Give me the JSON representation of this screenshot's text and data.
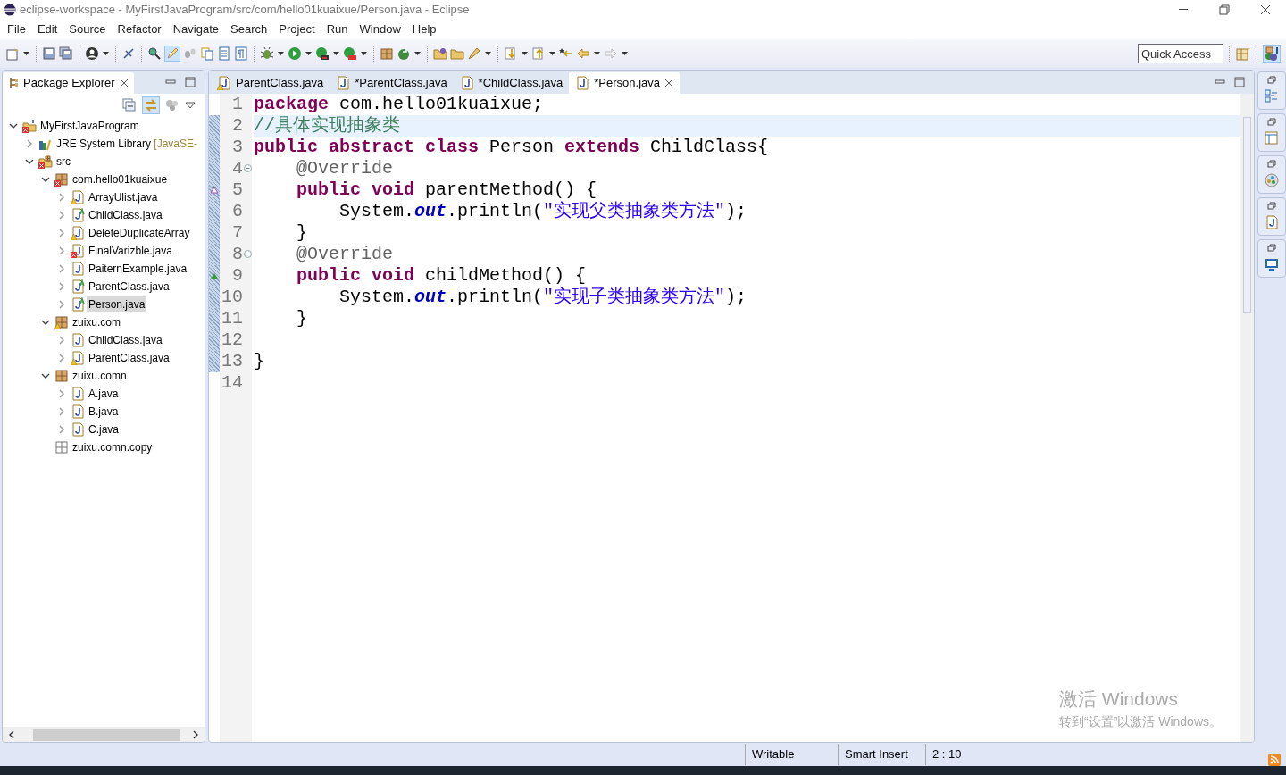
{
  "window": {
    "title": "eclipse-workspace - MyFirstJavaProgram/src/com/hello01kuaixue/Person.java - Eclipse"
  },
  "menu": [
    "File",
    "Edit",
    "Source",
    "Refactor",
    "Navigate",
    "Search",
    "Project",
    "Run",
    "Window",
    "Help"
  ],
  "quick_access": {
    "placeholder": "Quick Access"
  },
  "package_explorer": {
    "title": "Package Explorer",
    "link_with_editor": true,
    "tree": [
      {
        "label": "MyFirstJavaProgram",
        "kind": "project",
        "error": true,
        "expanded": true,
        "selected": false,
        "children": [
          {
            "label": "JRE System Library",
            "decoration": "[JavaSE-",
            "kind": "library",
            "expanded": false,
            "selected": false
          },
          {
            "label": "src",
            "kind": "folder",
            "error": true,
            "expanded": true,
            "selected": false,
            "children": [
              {
                "label": "com.hello01kuaixue",
                "kind": "package",
                "error": true,
                "expanded": true,
                "selected": false,
                "children": [
                  {
                    "label": "ArrayUlist.java",
                    "kind": "file",
                    "warning": true,
                    "expanded": false,
                    "selected": false
                  },
                  {
                    "label": "ChildClass.java",
                    "kind": "file",
                    "abstract": true,
                    "expanded": false,
                    "selected": false
                  },
                  {
                    "label": "DeleteDuplicateArray",
                    "kind": "file",
                    "warning": true,
                    "expanded": false,
                    "selected": false
                  },
                  {
                    "label": "FinalVarizble.java",
                    "kind": "file",
                    "error": true,
                    "expanded": false,
                    "selected": false
                  },
                  {
                    "label": "PaiternExample.java",
                    "kind": "file",
                    "expanded": false,
                    "selected": false
                  },
                  {
                    "label": "ParentClass.java",
                    "kind": "file",
                    "abstract": true,
                    "expanded": false,
                    "selected": false
                  },
                  {
                    "label": "Person.java",
                    "kind": "file",
                    "abstract": true,
                    "expanded": false,
                    "selected": true
                  }
                ]
              },
              {
                "label": "zuixu.com",
                "kind": "package",
                "warning": true,
                "expanded": true,
                "selected": false,
                "children": [
                  {
                    "label": "ChildClass.java",
                    "kind": "file",
                    "expanded": false,
                    "selected": false
                  },
                  {
                    "label": "ParentClass.java",
                    "kind": "file",
                    "warning": true,
                    "expanded": false,
                    "selected": false
                  }
                ]
              },
              {
                "label": "zuixu.comn",
                "kind": "package",
                "expanded": true,
                "selected": false,
                "children": [
                  {
                    "label": "A.java",
                    "kind": "file",
                    "expanded": false,
                    "selected": false
                  },
                  {
                    "label": "B.java",
                    "kind": "file",
                    "expanded": false,
                    "selected": false
                  },
                  {
                    "label": "C.java",
                    "kind": "file",
                    "expanded": false,
                    "selected": false
                  }
                ]
              },
              {
                "label": "zuixu.comn.copy",
                "kind": "empty-package",
                "selected": false
              }
            ]
          }
        ]
      }
    ]
  },
  "editor_tabs": [
    {
      "label": "ParentClass.java",
      "warning": true,
      "selected": false
    },
    {
      "label": "*ParentClass.java",
      "selected": false
    },
    {
      "label": "*ChildClass.java",
      "selected": false
    },
    {
      "label": "*Person.java",
      "selected": true
    }
  ],
  "code_lines": [
    {
      "number": "1",
      "changed": false,
      "current": false,
      "tokens": [
        {
          "kind": "keyword",
          "text": "package"
        },
        {
          "kind": "plain",
          "text": " com.hello01kuaixue;"
        }
      ]
    },
    {
      "number": "2",
      "changed": true,
      "current": true,
      "tokens": [
        {
          "kind": "comment",
          "text": "//具体实现抽象类"
        }
      ]
    },
    {
      "number": "3",
      "changed": true,
      "current": false,
      "tokens": [
        {
          "kind": "keyword",
          "text": "public"
        },
        {
          "kind": "keyword",
          "text": " abstract"
        },
        {
          "kind": "keyword",
          "text": " class"
        },
        {
          "kind": "plain",
          "text": " Person"
        },
        {
          "kind": "keyword",
          "text": " extends"
        },
        {
          "kind": "plain",
          "text": " ChildClass{"
        }
      ]
    },
    {
      "number": "4",
      "changed": true,
      "current": false,
      "fold": true,
      "tokens": [
        {
          "kind": "annotation",
          "text": "    @Override"
        }
      ]
    },
    {
      "number": "5",
      "changed": true,
      "current": false,
      "overrides": true,
      "tokens": [
        {
          "kind": "keyword",
          "text": "    public"
        },
        {
          "kind": "keyword",
          "text": " void"
        },
        {
          "kind": "plain",
          "text": " parentMethod() {"
        }
      ]
    },
    {
      "number": "6",
      "changed": true,
      "current": false,
      "tokens": [
        {
          "kind": "plain",
          "text": "        System."
        },
        {
          "kind": "field",
          "text": "out"
        },
        {
          "kind": "plain",
          "text": ".println("
        },
        {
          "kind": "string",
          "text": "\"实现父类抽象类方法\""
        },
        {
          "kind": "plain",
          "text": ");"
        }
      ]
    },
    {
      "number": "7",
      "changed": true,
      "current": false,
      "tokens": [
        {
          "kind": "plain",
          "text": "    }"
        }
      ]
    },
    {
      "number": "8",
      "changed": true,
      "current": false,
      "fold": true,
      "tokens": [
        {
          "kind": "annotation",
          "text": "    @Override"
        }
      ]
    },
    {
      "number": "9",
      "changed": true,
      "current": false,
      "implements": true,
      "tokens": [
        {
          "kind": "keyword",
          "text": "    public"
        },
        {
          "kind": "keyword",
          "text": " void"
        },
        {
          "kind": "plain",
          "text": " childMethod() {"
        }
      ]
    },
    {
      "number": "10",
      "changed": true,
      "current": false,
      "tokens": [
        {
          "kind": "plain",
          "text": "        System."
        },
        {
          "kind": "field",
          "text": "out"
        },
        {
          "kind": "plain",
          "text": ".println("
        },
        {
          "kind": "string",
          "text": "\"实现子类抽象类方法\""
        },
        {
          "kind": "plain",
          "text": ");"
        }
      ]
    },
    {
      "number": "11",
      "changed": true,
      "current": false,
      "tokens": [
        {
          "kind": "plain",
          "text": "    }"
        }
      ]
    },
    {
      "number": "12",
      "changed": true,
      "current": false
    },
    {
      "number": "13",
      "changed": true,
      "current": false,
      "tokens": [
        {
          "kind": "plain",
          "text": "}"
        }
      ]
    },
    {
      "number": "14",
      "changed": false,
      "current": false
    }
  ],
  "activation_notice": {
    "title": "激活 Windows",
    "subtitle": "转到“设置”以激活 Windows。"
  },
  "status_bar": [
    "Writable",
    "Smart Insert",
    "2 : 10"
  ]
}
